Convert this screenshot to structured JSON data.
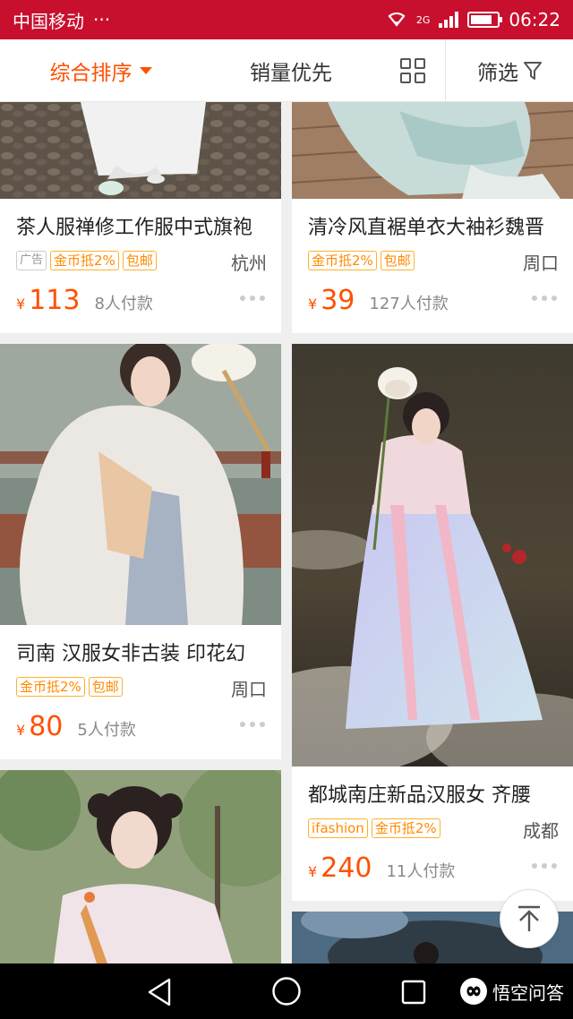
{
  "status_bar": {
    "carrier": "中国移动",
    "more": "···",
    "network": "2G",
    "time": "06:22",
    "battery_level": 0.8
  },
  "sort_bar": {
    "comprehensive_label": "综合排序",
    "sales_label": "销量优先",
    "filter_label": "筛选"
  },
  "products": [
    {
      "title": "茶人服禅修工作服中式旗袍",
      "tags": [
        "广告",
        "金币抵2%",
        "包邮"
      ],
      "city": "杭州",
      "currency": "¥",
      "price": "113",
      "sold": "8人付款"
    },
    {
      "title": "清冷风直裾单衣大袖衫魏晋",
      "tags": [
        "金币抵2%",
        "包邮"
      ],
      "city": "周口",
      "currency": "¥",
      "price": "39",
      "sold": "127人付款"
    },
    {
      "title": "司南 汉服女非古装 印花幻",
      "tags": [
        "金币抵2%",
        "包邮"
      ],
      "city": "周口",
      "currency": "¥",
      "price": "80",
      "sold": "5人付款"
    },
    {
      "title": "都城南庄新品汉服女 齐腰",
      "tags": [
        "ifashion",
        "金币抵2%"
      ],
      "city": "成都",
      "currency": "¥",
      "price": "240",
      "sold": "11人付款"
    }
  ],
  "watermark": {
    "text": "悟空问答"
  }
}
